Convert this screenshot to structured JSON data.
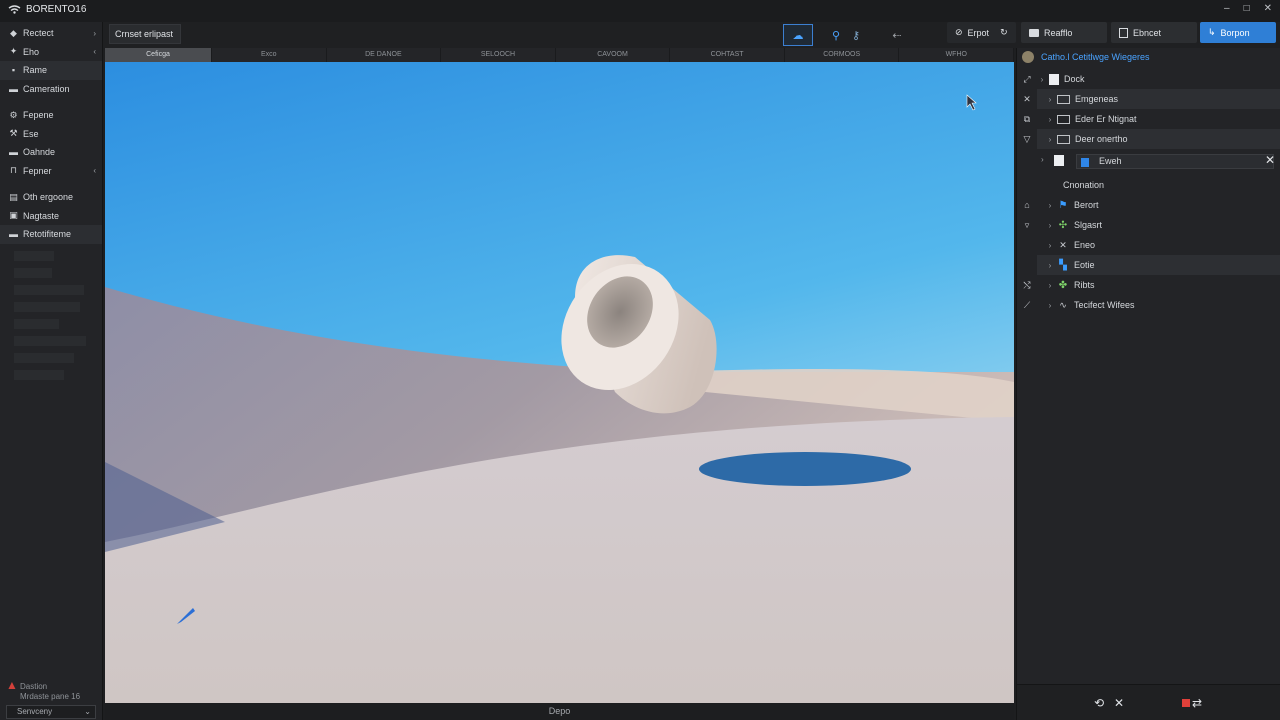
{
  "app": {
    "title": "BORENTO16"
  },
  "window_controls": [
    "–",
    "□",
    "✕"
  ],
  "sidebar": {
    "items": [
      {
        "label": "Rectect",
        "icon": "layers-icon",
        "chev": "›"
      },
      {
        "label": "Eho",
        "icon": "arrow-icon",
        "chev": "‹"
      },
      {
        "label": "Rame",
        "icon": "pin-icon",
        "selected": true
      },
      {
        "label": "Cameration",
        "icon": "camera-icon"
      },
      {
        "label": "Fepene",
        "icon": "gear-icon"
      },
      {
        "label": "Ese",
        "icon": "tool-icon"
      },
      {
        "label": "Oahnde",
        "icon": "block-icon"
      },
      {
        "label": "Fepner",
        "icon": "bracket-icon",
        "chev": "‹"
      },
      {
        "label": "Oth ergoone",
        "icon": "doc-icon"
      },
      {
        "label": "Nagtaste",
        "icon": "image-icon"
      },
      {
        "label": "Retotifiteme",
        "icon": "folder-icon",
        "selected": true
      }
    ],
    "bottom_title": "Dastion\nMrdaste pane 16",
    "dropdown": "Senvceny"
  },
  "toolbar": {
    "breadcrumb": "Crnset erlipast",
    "tool_buttons": [
      "☁",
      "⚲",
      "⚷",
      "⇠"
    ],
    "dropdown_label": "Erpot",
    "panel_tabs": [
      "Reafflo",
      "Ebncet"
    ],
    "primary_button": "Borpon"
  },
  "viewport": {
    "tabs": [
      "Ceficga",
      "Exco",
      "DE DANOE",
      "SELOOCH",
      "CAVOOM",
      "COHTAST",
      "CORMOOS",
      "WFHO"
    ],
    "footer": "Depo"
  },
  "outliner": {
    "title": "Catho.l Cetitlwge Wiegeres",
    "rows": [
      {
        "label": "Dock",
        "indent": 1,
        "icon": "doc",
        "tool": "⤢"
      },
      {
        "label": "Emgeneas",
        "indent": 1,
        "icon": "box",
        "tool": "✕",
        "highlight": true
      },
      {
        "label": "Eder Er Ntignat",
        "indent": 1,
        "icon": "box",
        "tool": "⧉"
      },
      {
        "label": "Deer onertho",
        "indent": 1,
        "icon": "box",
        "tool": "▽",
        "highlight": true
      },
      {
        "label": "Eweh",
        "selected": true
      },
      {
        "label": "Cnonation",
        "indent": 2,
        "icon": "none"
      },
      {
        "label": "Berort",
        "indent": 1,
        "icon": "blue-glyph",
        "tool": "⌂"
      },
      {
        "label": "Slgasrt",
        "indent": 1,
        "icon": "green-glyph",
        "tool": "▿"
      },
      {
        "label": "Eneo",
        "indent": 1,
        "icon": "plain"
      },
      {
        "label": "Eotie",
        "indent": 1,
        "icon": "blue-glyph",
        "highlight": true
      },
      {
        "label": "Ribts",
        "indent": 1,
        "icon": "green-glyph",
        "tool": "⤭"
      },
      {
        "label": "Tecifect Wifees",
        "indent": 1,
        "icon": "plain",
        "tool": "⟋"
      }
    ],
    "footer_buttons": [
      "⟲",
      "✕",
      "⇄"
    ]
  },
  "colors": {
    "accent": "#2f7fd6",
    "sky_top": "#2b8fe0",
    "sky_bottom": "#8ed3ee",
    "ground": "#cfc7c7",
    "ring": "#e3dbd6"
  }
}
